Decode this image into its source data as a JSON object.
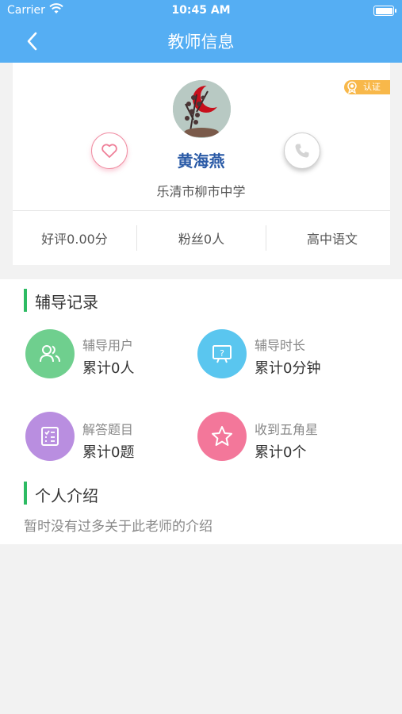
{
  "status_bar": {
    "carrier": "Carrier",
    "time": "10:45 AM"
  },
  "nav": {
    "title": "教师信息"
  },
  "profile": {
    "badge_label": "认证",
    "name": "黄海燕",
    "school": "乐清市柳市中学",
    "stats": [
      "好评0.00分",
      "粉丝0人",
      "高中语文"
    ]
  },
  "records": {
    "title": "辅导记录",
    "items": [
      {
        "label": "辅导用户",
        "value": "累计0人",
        "icon": "users-icon",
        "color": "#6fcf8e"
      },
      {
        "label": "辅导时长",
        "value": "累计0分钟",
        "icon": "question-board-icon",
        "color": "#5ac6ef"
      },
      {
        "label": "解答题目",
        "value": "累计0题",
        "icon": "checklist-icon",
        "color": "#b98ee0"
      },
      {
        "label": "收到五角星",
        "value": "累计0个",
        "icon": "star-icon",
        "color": "#f3779a"
      }
    ]
  },
  "intro": {
    "title": "个人介绍",
    "text": "暂时没有过多关于此老师的介绍"
  },
  "colors": {
    "header": "#55aef3",
    "accent_bar": "#2dbb63",
    "name": "#2a5aa6",
    "badge": "#f8b84a"
  }
}
